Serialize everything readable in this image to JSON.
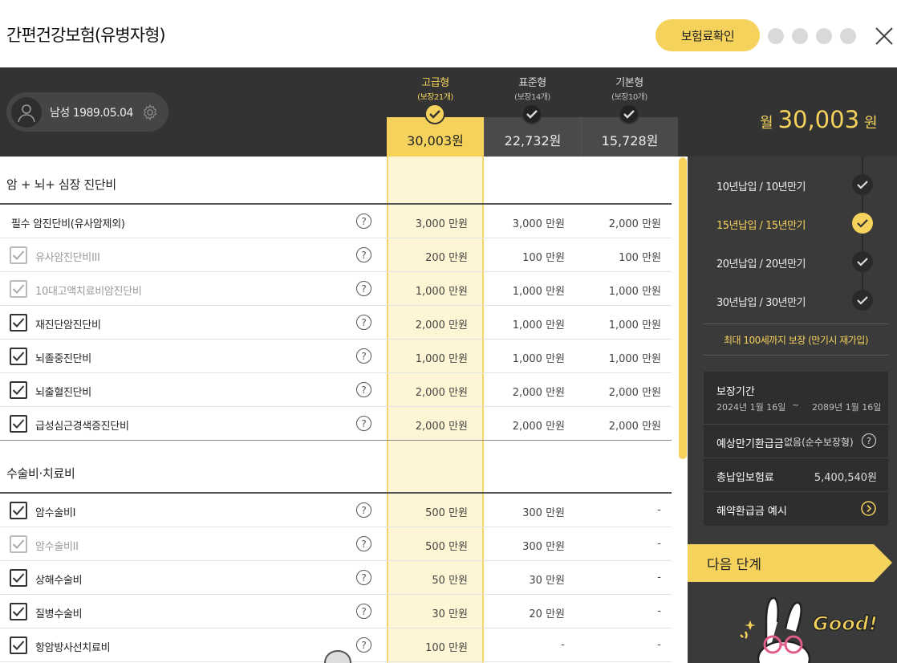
{
  "title": "간편건강보험(유병자형)",
  "confirm_button": "보험료확인",
  "user": {
    "info": "남성 1989.05.04"
  },
  "plans": [
    {
      "name": "고급형",
      "coverage": "(보장21개)",
      "price": "30,003원",
      "selected": true
    },
    {
      "name": "표준형",
      "coverage": "(보장14개)",
      "price": "22,732원",
      "selected": false
    },
    {
      "name": "기본형",
      "coverage": "(보장10개)",
      "price": "15,728원",
      "selected": false
    }
  ],
  "total": {
    "prefix": "월",
    "amount": "30,003",
    "unit": "원"
  },
  "sections": [
    {
      "title": "암 + 뇌+ 심장 진단비",
      "rows": [
        {
          "label": "필수 암진단비(유사암제외)",
          "checkbox": "none",
          "values": [
            "3,000 만원",
            "3,000 만원",
            "2,000 만원"
          ]
        },
        {
          "label": "유사암진단비III",
          "checkbox": "dim",
          "values": [
            "200 만원",
            "100 만원",
            "100 만원"
          ]
        },
        {
          "label": "10대고액치료비암진단비",
          "checkbox": "dim",
          "values": [
            "1,000 만원",
            "1,000 만원",
            "1,000 만원"
          ]
        },
        {
          "label": "재진단암진단비",
          "checkbox": "on",
          "values": [
            "2,000 만원",
            "1,000 만원",
            "1,000 만원"
          ]
        },
        {
          "label": "뇌졸중진단비",
          "checkbox": "on",
          "values": [
            "1,000 만원",
            "1,000 만원",
            "1,000 만원"
          ]
        },
        {
          "label": "뇌출혈진단비",
          "checkbox": "on",
          "values": [
            "2,000 만원",
            "2,000 만원",
            "2,000 만원"
          ]
        },
        {
          "label": "급성심근경색증진단비",
          "checkbox": "on",
          "values": [
            "2,000 만원",
            "2,000 만원",
            "2,000 만원"
          ]
        }
      ]
    },
    {
      "title": "수술비·치료비",
      "rows": [
        {
          "label": "암수술비I",
          "checkbox": "on",
          "values": [
            "500 만원",
            "300 만원",
            "-"
          ]
        },
        {
          "label": "암수술비II",
          "checkbox": "dim",
          "values": [
            "500 만원",
            "300 만원",
            "-"
          ]
        },
        {
          "label": "상해수술비",
          "checkbox": "on",
          "values": [
            "50 만원",
            "30 만원",
            "-"
          ]
        },
        {
          "label": "질병수술비",
          "checkbox": "on",
          "values": [
            "30 만원",
            "20 만원",
            "-"
          ]
        },
        {
          "label": "항암방사선치료비",
          "checkbox": "on",
          "values": [
            "100 만원",
            "-",
            "-"
          ]
        }
      ]
    }
  ],
  "terms": [
    {
      "label": "10년납입 / 10년만기",
      "selected": false
    },
    {
      "label": "15년납입 / 15년만기",
      "selected": true
    },
    {
      "label": "20년납입 / 20년만기",
      "selected": false
    },
    {
      "label": "30년납입 / 30년만기",
      "selected": false
    }
  ],
  "max_note": "최대 100세까지 보장 (만기시 재가입)",
  "info": {
    "period_label": "보장기간",
    "period_start": "2024년 1월 16일",
    "period_sep": "~",
    "period_end": "2089년 1월 16일",
    "refund_label": "예상만기환급금",
    "refund_value": "없음(순수보장형)",
    "total_label": "총납입보험료",
    "total_value": "5,400,540원",
    "cancel_label": "해약환급금 예시"
  },
  "next_button": "다음 단계",
  "mascot_text": "Good!",
  "colors": {
    "accent": "#f4d25c",
    "dark": "#333333",
    "panel": "#3a3a3a"
  }
}
